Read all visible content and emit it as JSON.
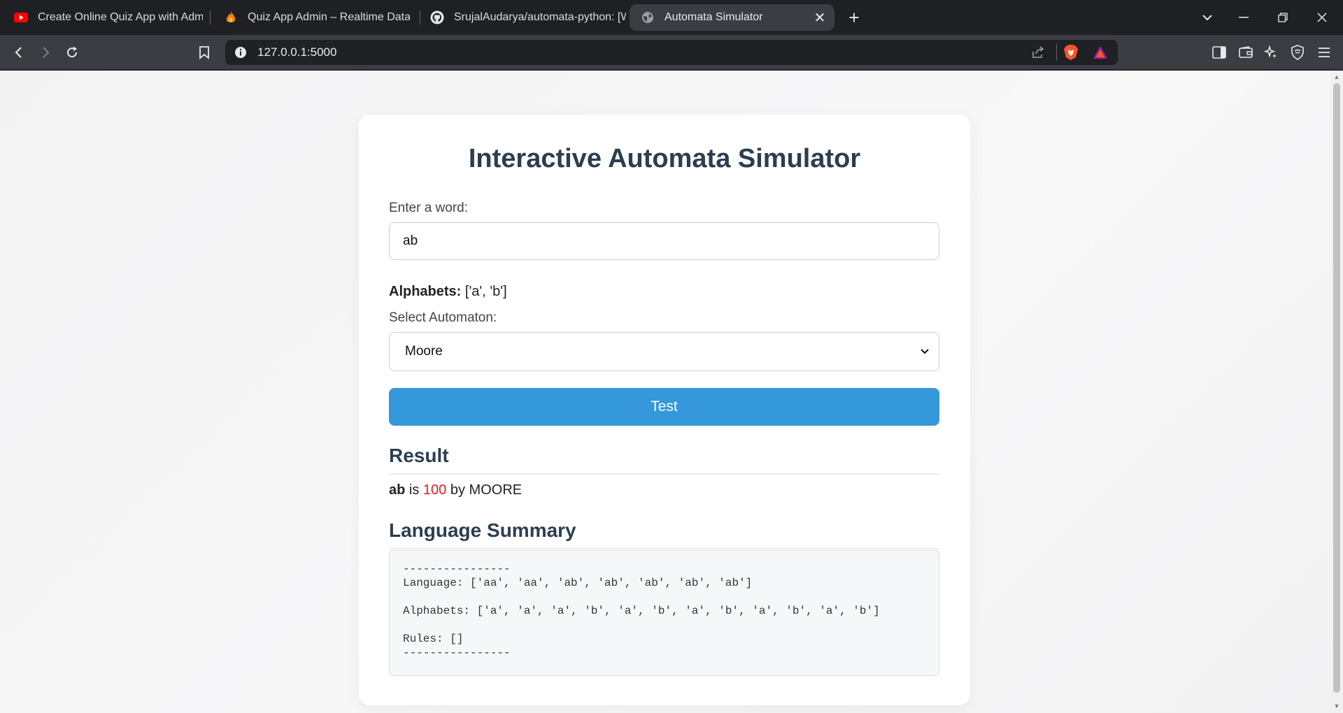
{
  "tabs": [
    {
      "label": "Create Online Quiz App with Admin",
      "icon": "youtube-icon"
    },
    {
      "label": "Quiz App Admin – Realtime Database",
      "icon": "firebase-icon"
    },
    {
      "label": "SrujalAudarya/automata-python: [W",
      "icon": "github-icon"
    },
    {
      "label": "Automata Simulator",
      "icon": "globe-icon",
      "active": true
    }
  ],
  "toolbar": {
    "url": "127.0.0.1:5000"
  },
  "page": {
    "title": "Interactive Automata Simulator",
    "word_label": "Enter a word:",
    "word_value": "ab",
    "alphabets_label": "Alphabets:",
    "alphabets_value": "['a', 'b']",
    "select_label": "Select Automaton:",
    "select_value": "Moore",
    "test_button": "Test",
    "result_heading": "Result",
    "result": {
      "word": "ab",
      "is": "is",
      "value": "100",
      "by": "by MOORE"
    },
    "summary_heading": "Language Summary",
    "summary_lines": {
      "divider_top": "----------------",
      "language": "Language: ['aa', 'aa', 'ab', 'ab', 'ab', 'ab', 'ab']",
      "alphabets": "Alphabets: ['a', 'a', 'a', 'b', 'a', 'b', 'a', 'b', 'a', 'b', 'a', 'b']",
      "rules": "Rules: []",
      "divider_bottom": "----------------"
    }
  },
  "colors": {
    "accent": "#3498db",
    "heading": "#2c3e50",
    "result_value": "#e01b24"
  }
}
